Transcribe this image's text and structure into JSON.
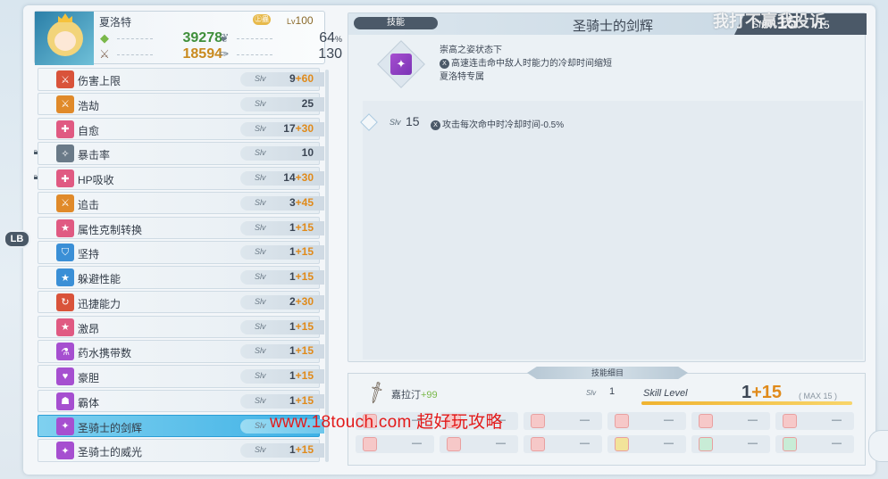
{
  "character": {
    "name": "夏洛特",
    "rank_label": "㊤蟲",
    "level_prefix": "Lv",
    "level": "100",
    "stat1_value": "39278",
    "stat2_value": "18594",
    "stat3_value": "64",
    "stat3_unit": "%",
    "stat4_value": "130"
  },
  "lb_tab": "LB",
  "skills": [
    {
      "name": "伤害上限",
      "slv": "Slv",
      "base": "9",
      "bonus": "+60",
      "color": "#d9533a",
      "icon": "⚔",
      "locked": false
    },
    {
      "name": "浩劫",
      "slv": "Slv",
      "base": "25",
      "bonus": "",
      "color": "#e08a2a",
      "icon": "⚔",
      "locked": false
    },
    {
      "name": "自愈",
      "slv": "Slv",
      "base": "17",
      "bonus": "+30",
      "color": "#e05a82",
      "icon": "✚",
      "locked": false
    },
    {
      "name": "暴击率",
      "slv": "Slv",
      "base": "10",
      "bonus": "",
      "color": "#6a7a88",
      "icon": "✧",
      "locked": true
    },
    {
      "name": "HP吸收",
      "slv": "Slv",
      "base": "14",
      "bonus": "+30",
      "color": "#e05a82",
      "icon": "✚",
      "locked": true
    },
    {
      "name": "追击",
      "slv": "Slv",
      "base": "3",
      "bonus": "+45",
      "color": "#e08a2a",
      "icon": "⚔",
      "locked": false
    },
    {
      "name": "属性克制转换",
      "slv": "Slv",
      "base": "1",
      "bonus": "+15",
      "color": "#e05a82",
      "icon": "★",
      "locked": false
    },
    {
      "name": "坚持",
      "slv": "Slv",
      "base": "1",
      "bonus": "+15",
      "color": "#3a8fd6",
      "icon": "⛉",
      "locked": false
    },
    {
      "name": "躲避性能",
      "slv": "Slv",
      "base": "1",
      "bonus": "+15",
      "color": "#3a8fd6",
      "icon": "★",
      "locked": false
    },
    {
      "name": "迅捷能力",
      "slv": "Slv",
      "base": "2",
      "bonus": "+30",
      "color": "#d9533a",
      "icon": "↻",
      "locked": false
    },
    {
      "name": "激昂",
      "slv": "Slv",
      "base": "1",
      "bonus": "+15",
      "color": "#e05a82",
      "icon": "★",
      "locked": false
    },
    {
      "name": "药水携带数",
      "slv": "Slv",
      "base": "1",
      "bonus": "+15",
      "color": "#a64fd0",
      "icon": "⚗",
      "locked": false
    },
    {
      "name": "豪胆",
      "slv": "Slv",
      "base": "1",
      "bonus": "+15",
      "color": "#a64fd0",
      "icon": "♥",
      "locked": false
    },
    {
      "name": "霸体",
      "slv": "Slv",
      "base": "1",
      "bonus": "+15",
      "color": "#a64fd0",
      "icon": "☗",
      "locked": false
    },
    {
      "name": "圣骑士的剑辉",
      "slv": "Slv",
      "base": "",
      "bonus": "",
      "color": "#a64fd0",
      "icon": "✦",
      "locked": false,
      "selected": true
    },
    {
      "name": "圣骑士的威光",
      "slv": "Slv",
      "base": "1",
      "bonus": "+15",
      "color": "#a64fd0",
      "icon": "✦",
      "locked": false
    }
  ],
  "detail": {
    "tag": "技能",
    "title": "圣骑士的剑辉",
    "slv_label": "Slv",
    "slv_value": "15",
    "slv_max": "/15",
    "desc_line1": "崇高之姿状态下",
    "desc_line2": "高速连击命中敌人时能力的冷却时间缩短",
    "desc_line3": "夏洛特专属",
    "xbadge": "X",
    "effect_slv": "Slv",
    "effect_level": "15",
    "effect_text": "攻击每次命中时冷却时间-0.5%"
  },
  "bottom": {
    "tab_label": "技能细目",
    "equip_name": "嘉拉汀",
    "equip_plus": "+99",
    "equip_slv": "Slv",
    "equip_slv_value": "1",
    "skill_level_label": "Skill Level",
    "skill_level_base": "1",
    "skill_level_bonus": "+15",
    "skill_level_max": "( MAX 15 )",
    "skill_level_fraction": 1.0,
    "gem_dash": "—"
  },
  "watermark": "www.18touch.com 超好玩攻略",
  "watermark_top": "我打不赢我投诉"
}
